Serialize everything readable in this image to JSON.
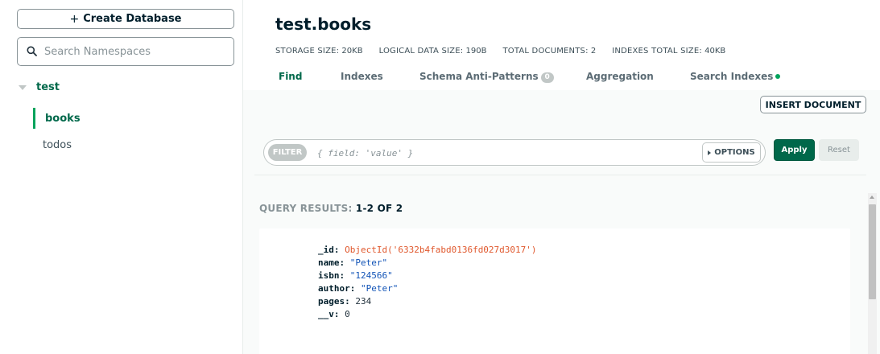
{
  "sidebar": {
    "create_label": "Create Database",
    "search_placeholder": "Search Namespaces",
    "database": "test",
    "collections": [
      "books",
      "todos"
    ]
  },
  "header": {
    "title": "test.books",
    "stats": [
      {
        "label": "STORAGE SIZE:",
        "value": "20KB"
      },
      {
        "label": "LOGICAL DATA SIZE:",
        "value": "190B"
      },
      {
        "label": "TOTAL DOCUMENTS:",
        "value": "2"
      },
      {
        "label": "INDEXES TOTAL SIZE:",
        "value": "40KB"
      }
    ],
    "tabs": {
      "find": "Find",
      "indexes": "Indexes",
      "schema": "Schema Anti-Patterns",
      "schema_badge": "0",
      "aggregation": "Aggregation",
      "search": "Search Indexes"
    }
  },
  "toolbar": {
    "insert_label": "INSERT DOCUMENT",
    "filter_label": "FILTER",
    "filter_placeholder": "{ field: 'value' }",
    "options_label": "OPTIONS",
    "apply_label": "Apply",
    "reset_label": "Reset"
  },
  "results": {
    "label": "QUERY RESULTS:",
    "count": "1-2 OF 2",
    "document": {
      "_id_key": "_id:",
      "_id_val": "ObjectId('6332b4fabd0136fd027d3017')",
      "name_key": "name:",
      "name_val": "\"Peter\"",
      "isbn_key": "isbn:",
      "isbn_val": "\"124566\"",
      "author_key": "author:",
      "author_val": "\"Peter\"",
      "pages_key": "pages:",
      "pages_val": "234",
      "v_key": "__v:",
      "v_val": "0"
    }
  },
  "colors": {
    "accent": "#00684a",
    "accent_bright": "#00a35c",
    "objectid": "#e0582d",
    "string": "#1254b7"
  }
}
